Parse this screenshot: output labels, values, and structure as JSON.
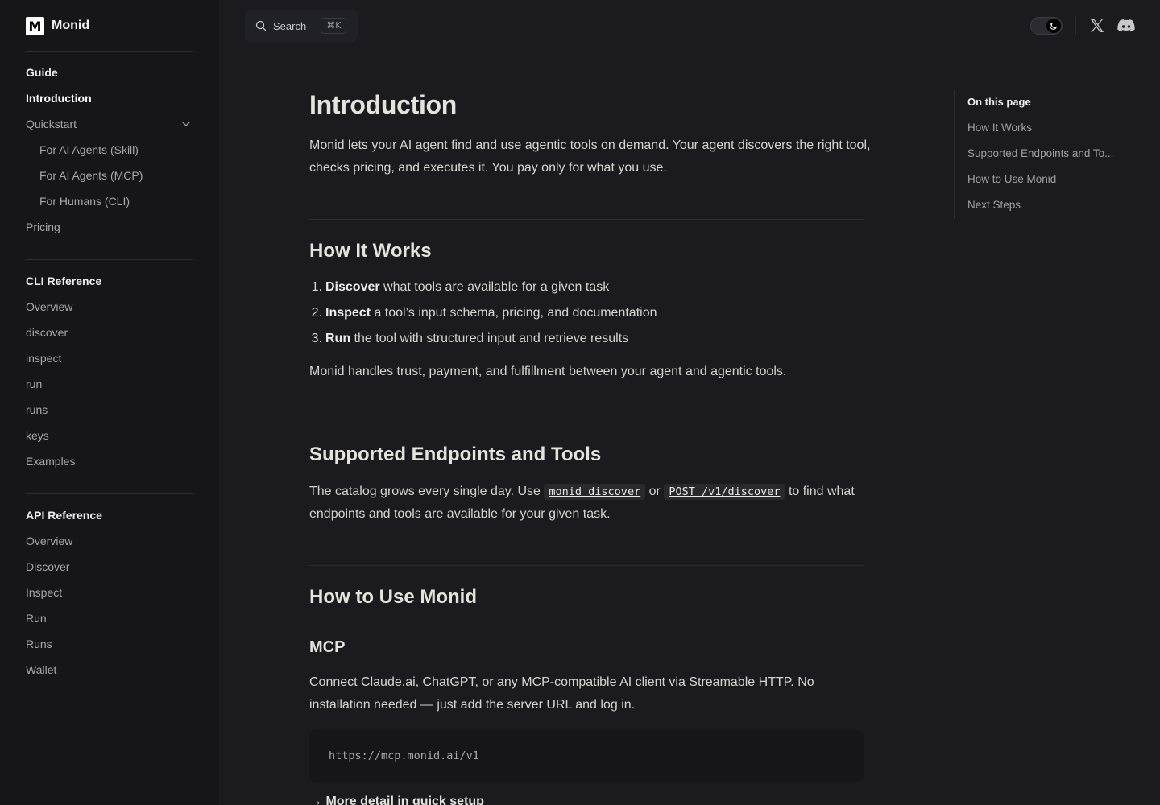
{
  "brand": {
    "mark": "M",
    "name": "Monid"
  },
  "sidebar": {
    "guide": {
      "title": "Guide",
      "introduction": "Introduction",
      "quickstart": "Quickstart",
      "quickstart_items": [
        "For AI Agents (Skill)",
        "For AI Agents (MCP)",
        "For Humans (CLI)"
      ],
      "pricing": "Pricing"
    },
    "cli": {
      "title": "CLI Reference",
      "items": [
        "Overview",
        "discover",
        "inspect",
        "run",
        "runs",
        "keys",
        "Examples"
      ]
    },
    "api": {
      "title": "API Reference",
      "items": [
        "Overview",
        "Discover",
        "Inspect",
        "Run",
        "Runs",
        "Wallet"
      ]
    }
  },
  "topbar": {
    "search_label": "Search",
    "shortcut": "⌘K"
  },
  "main": {
    "title": "Introduction",
    "intro": "Monid lets your AI agent find and use agentic tools on demand. Your agent discovers the right tool, checks pricing, and executes it. You pay only for what you use.",
    "how_it_works": {
      "heading": "How It Works",
      "steps": [
        {
          "num": "1.",
          "bold": "Discover",
          "rest": " what tools are available for a given task"
        },
        {
          "num": "2.",
          "bold": "Inspect",
          "rest": " a tool’s input schema, pricing, and documentation"
        },
        {
          "num": "3.",
          "bold": "Run",
          "rest": " the tool with structured input and retrieve results"
        }
      ],
      "summary": "Monid handles trust, payment, and fulfillment between your agent and agentic tools."
    },
    "endpoints": {
      "heading": "Supported Endpoints and Tools",
      "text_before": "The catalog grows every single day. Use ",
      "code1": "monid discover",
      "text_mid": " or ",
      "code2": "POST /v1/discover",
      "text_after": " to find what endpoints and tools are available for your given task."
    },
    "how_to_use": {
      "heading": "How to Use Monid",
      "mcp_heading": "MCP",
      "mcp_text": "Connect Claude.ai, ChatGPT, or any MCP-compatible AI client via Streamable HTTP. No installation needed — just add the server URL and log in.",
      "code": "https://mcp.monid.ai/v1",
      "more_link": "→ More detail in quick setup"
    }
  },
  "toc": {
    "title": "On this page",
    "items": [
      "How It Works",
      "Supported Endpoints and To...",
      "How to Use Monid",
      "Next Steps"
    ]
  }
}
